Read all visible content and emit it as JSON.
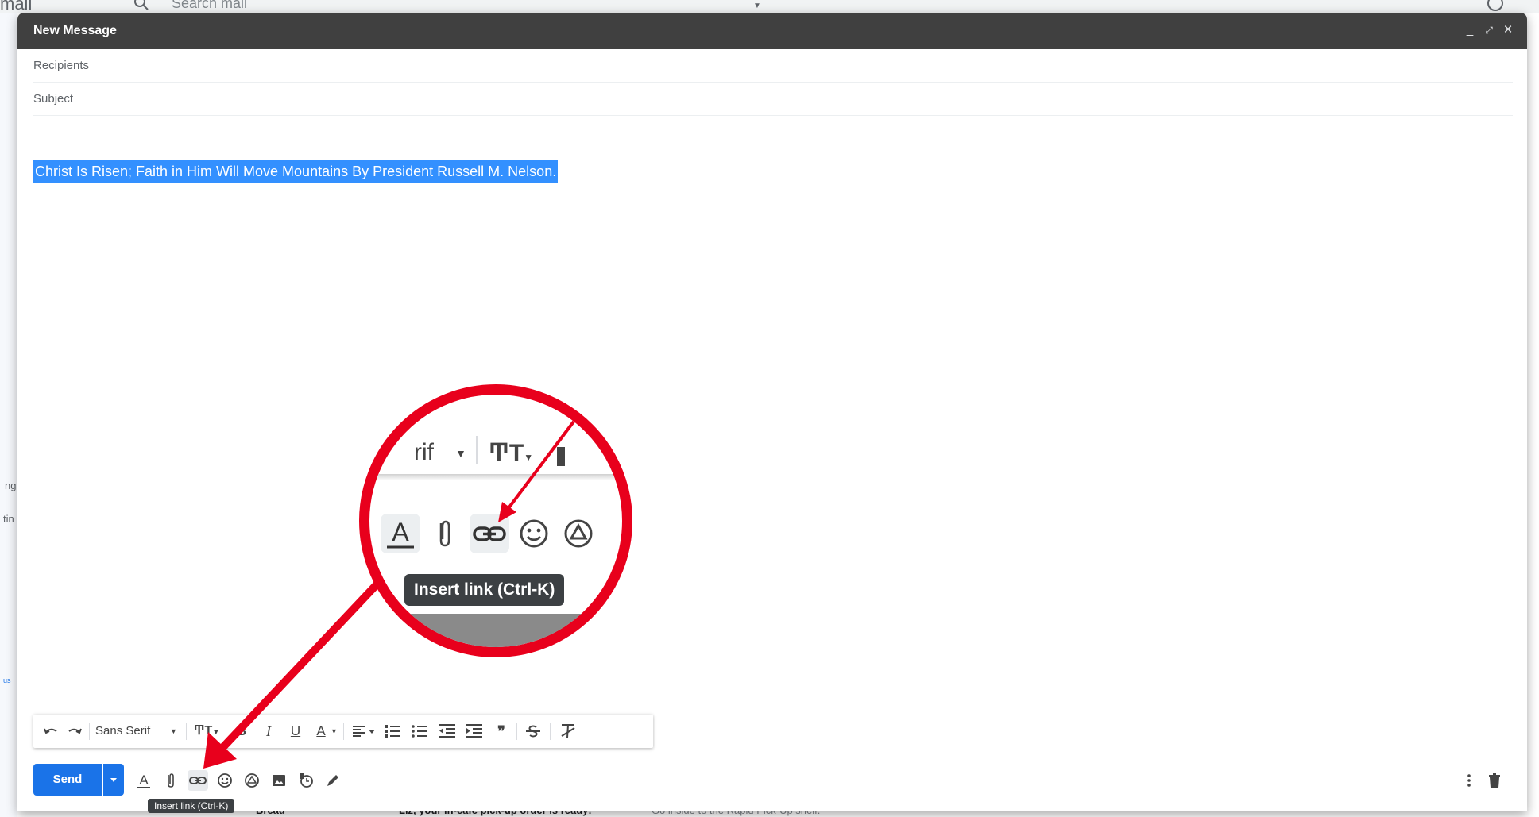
{
  "background": {
    "logo": "mail",
    "search_placeholder": "Search mail",
    "left_fragments": [
      "ng",
      "tin",
      "us"
    ],
    "bottom_row": {
      "sender": "Bread",
      "subject": "Liz, your in-cafe pick-up order is ready!",
      "snippet": "- Go inside to the Rapid Pick-Up shelf."
    }
  },
  "compose": {
    "title": "New Message",
    "header_buttons": {
      "minimize": "_",
      "expand": "⤢",
      "close": "×"
    },
    "recipients_placeholder": "Recipients",
    "subject_placeholder": "Subject",
    "body_text": "Christ Is Risen; Faith in Him Will Move Mountains By President Russell M. Nelson."
  },
  "formatting_toolbar": {
    "font_name": "Sans Serif",
    "bold": "B",
    "italic": "I",
    "underline": "U",
    "text_color": "A",
    "quote": "❞"
  },
  "action_bar": {
    "send_label": "Send",
    "text_format_letter": "A",
    "tooltip": "Insert link (Ctrl-K)"
  },
  "zoom_callout": {
    "font_fragment": "rif",
    "tooltip": "Insert link (Ctrl-K)",
    "text_format_letter": "A"
  },
  "colors": {
    "header": "#404040",
    "send": "#1a73e8",
    "selection": "#3390ff",
    "annotation": "#e8001c"
  },
  "icons": [
    "undo-icon",
    "redo-icon",
    "text-size-icon",
    "align-icon",
    "numbered-list-icon",
    "bulleted-list-icon",
    "indent-less-icon",
    "indent-more-icon",
    "strikethrough-icon",
    "remove-formatting-icon",
    "attach-icon",
    "link-icon",
    "emoji-icon",
    "drive-icon",
    "photo-icon",
    "confidential-icon",
    "signature-icon",
    "more-options-icon",
    "trash-icon"
  ]
}
